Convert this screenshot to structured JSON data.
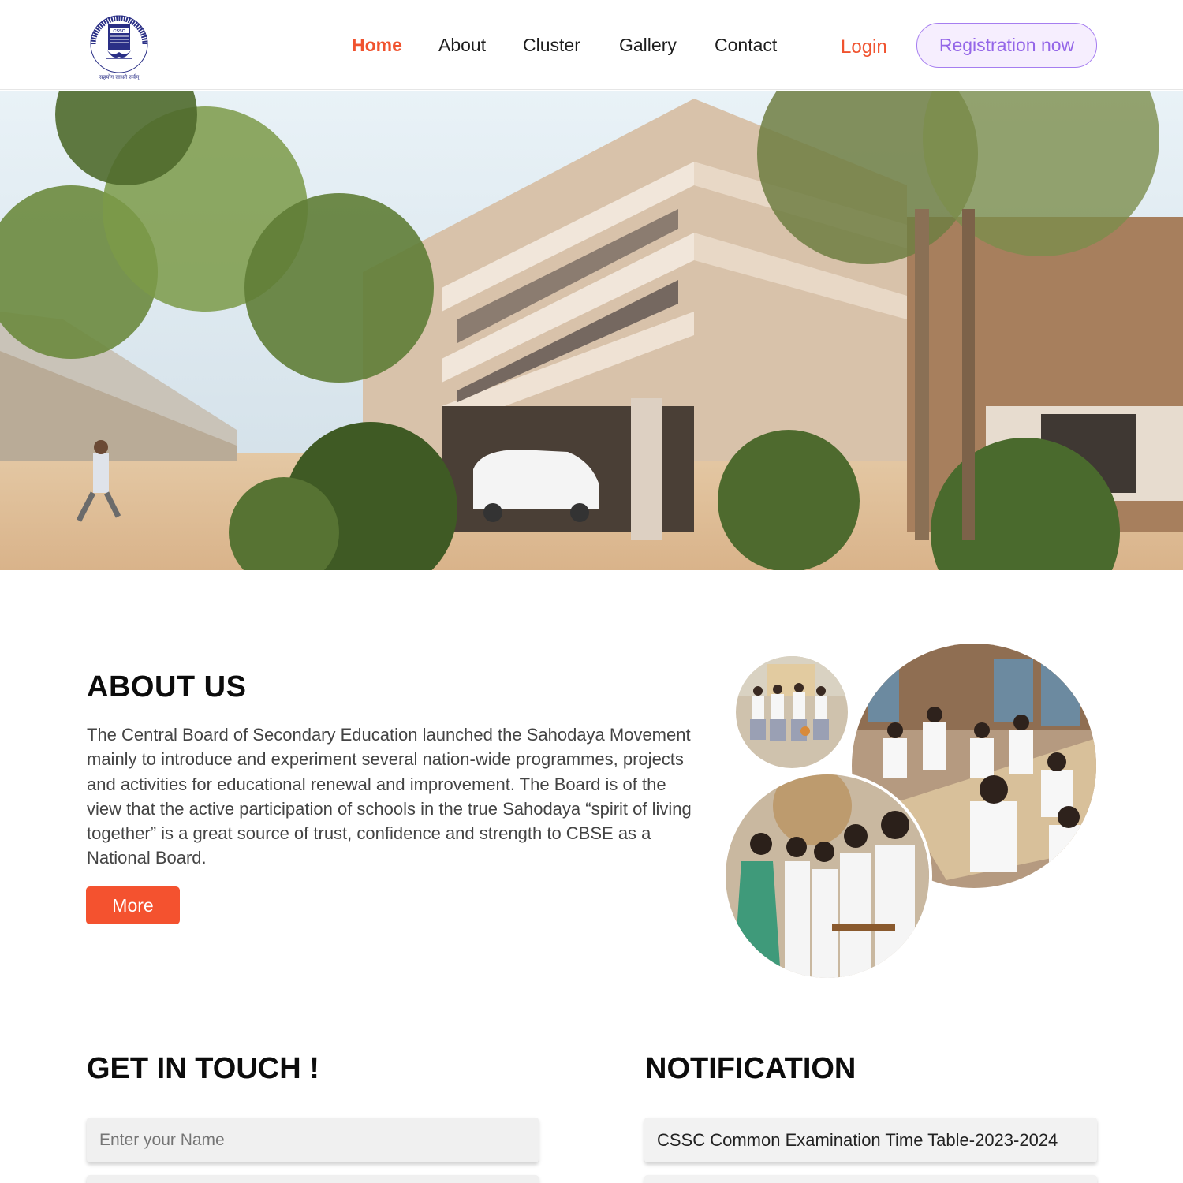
{
  "header": {
    "logo_text": "CHENNAI SAHODAYA SCHOOLS COMPLEX",
    "logo_badge": "CSSC",
    "nav": [
      {
        "label": "Home",
        "active": true
      },
      {
        "label": "About",
        "active": false
      },
      {
        "label": "Cluster",
        "active": false
      },
      {
        "label": "Gallery",
        "active": false
      },
      {
        "label": "Contact",
        "active": false
      }
    ],
    "login_label": "Login",
    "register_label": "Registration now"
  },
  "hero": {
    "image": "school-building-photo"
  },
  "about": {
    "title": "ABOUT US",
    "text": "The Central Board of Secondary Education launched the Sahodaya Movement mainly to introduce and experiment several nation-wide programmes, projects and activities for educational renewal and improvement. The Board is of the view that the active participation of schools in the true Sahodaya “spirit of living together” is a great source of trust, confidence and strength to CBSE as a National Board.",
    "more_label": "More",
    "photos": [
      "students-walking-photo",
      "students-library-photo",
      "students-teacher-photo"
    ]
  },
  "contact": {
    "title": "GET IN TOUCH !",
    "name_placeholder": "Enter your Name"
  },
  "notification": {
    "title": "NOTIFICATION",
    "items": [
      "CSSC Common Examination Time Table-2023-2024"
    ]
  },
  "colors": {
    "accent": "#f0532f",
    "register_border": "#a67ef0",
    "register_bg": "#f6eefe",
    "register_text": "#9466e8"
  }
}
